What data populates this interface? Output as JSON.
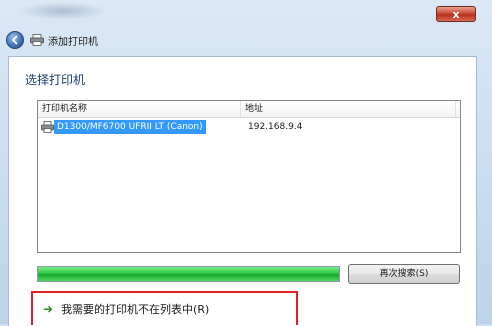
{
  "window": {
    "close_label": "x",
    "nav_title": "添加打印机"
  },
  "content": {
    "heading": "选择打印机",
    "list": {
      "columns": [
        "打印机名称",
        "地址"
      ],
      "rows": [
        {
          "name": "D1300/MF6700 UFRII LT (Canon)",
          "address": "192.168.9.4",
          "selected": true
        }
      ]
    },
    "progress": {
      "value": 1.0,
      "color": "#22c33a"
    },
    "search_again_label": "再次搜索(S)",
    "not_listed_label": "我需要的打印机不在列表中(R)"
  },
  "colors": {
    "heading": "#1c3b7a",
    "selection": "#3399ff",
    "highlight_border": "#e21f26",
    "arrow": "#2d8a2d"
  },
  "icons": {
    "back": "back-arrow-icon",
    "printer": "printer-icon",
    "link_arrow": "right-arrow-icon"
  }
}
